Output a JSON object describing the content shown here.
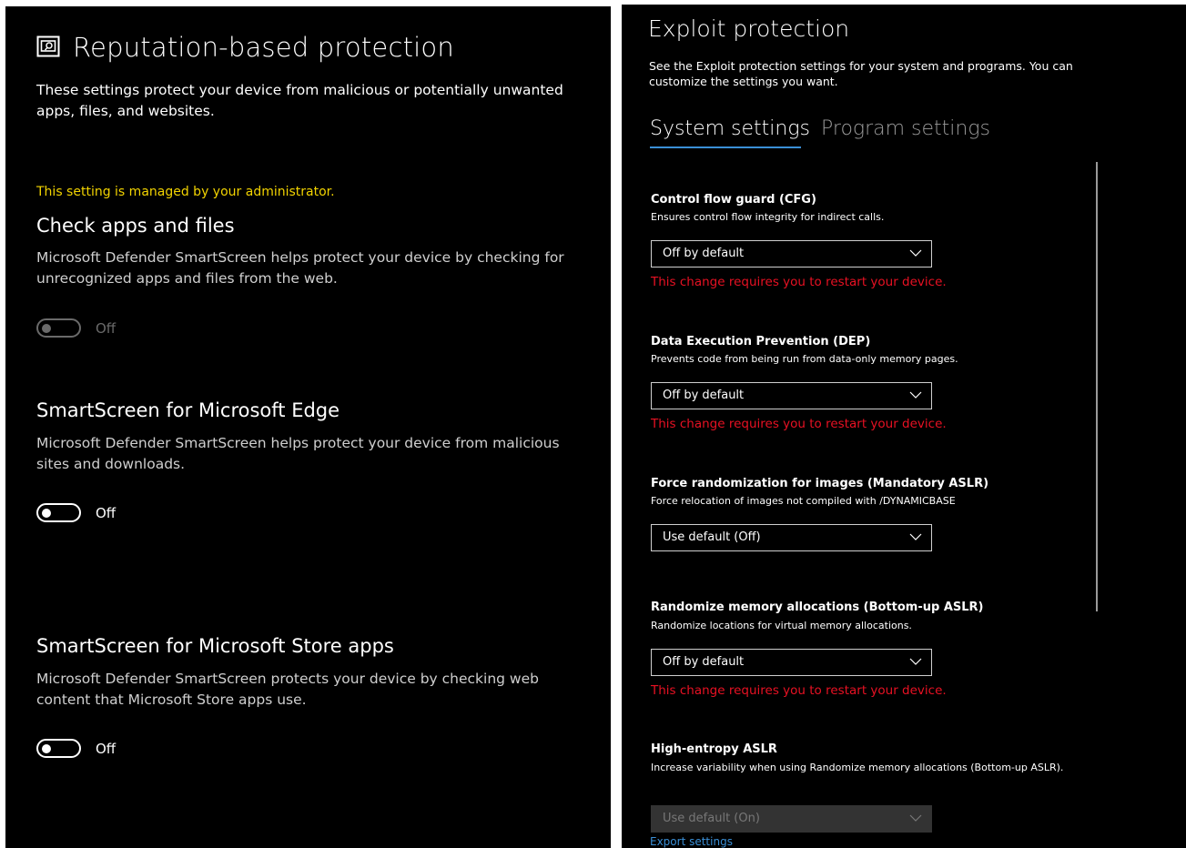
{
  "left": {
    "title": "Reputation-based protection",
    "description": "These settings protect your device from malicious or potentially unwanted apps, files, and websites.",
    "managed_notice": "This setting is managed by your administrator.",
    "sections": [
      {
        "heading": "Check apps and files",
        "text": "Microsoft Defender SmartScreen helps protect your device by checking for unrecognized apps and files from the web.",
        "toggle_label": "Off",
        "enabled": false
      },
      {
        "heading": "SmartScreen for Microsoft Edge",
        "text": "Microsoft Defender SmartScreen helps protect your device from malicious sites and downloads.",
        "toggle_label": "Off",
        "enabled": true
      },
      {
        "heading": "SmartScreen for Microsoft Store apps",
        "text": "Microsoft Defender SmartScreen protects your device by checking web content that Microsoft Store apps use.",
        "toggle_label": "Off",
        "enabled": true
      }
    ]
  },
  "right": {
    "title": "Exploit protection",
    "description": "See the Exploit protection settings for your system and programs.  You can customize the settings you want.",
    "tabs": [
      {
        "label": "System settings",
        "selected": true
      },
      {
        "label": "Program settings",
        "selected": false
      }
    ],
    "settings": [
      {
        "heading": "Control flow guard (CFG)",
        "description": "Ensures control flow integrity for indirect calls.",
        "value": "Off by default",
        "warning": "This change requires you to restart your device."
      },
      {
        "heading": "Data Execution Prevention (DEP)",
        "description": "Prevents code from being run from data-only memory pages.",
        "value": "Off by default",
        "warning": "This change requires you to restart your device."
      },
      {
        "heading": "Force randomization for images (Mandatory ASLR)",
        "description": "Force relocation of images not compiled with /DYNAMICBASE",
        "value": "Use default (Off)"
      },
      {
        "heading": "Randomize memory allocations (Bottom-up ASLR)",
        "description": "Randomize locations for virtual memory allocations.",
        "value": "Off by default",
        "warning": "This change requires you to restart your device."
      },
      {
        "heading": "High-entropy ASLR",
        "description": "Increase variability when using Randomize memory allocations (Bottom-up ASLR).",
        "value": "Use default (On)"
      }
    ],
    "export_link": "Export settings"
  },
  "colors": {
    "panel_bg": "#000000",
    "managed_notice": "#f2d300",
    "warning": "#e81123",
    "accent": "#3a8fd6",
    "disabled": "#6a6a6a"
  },
  "icons": [
    "reputation-shield-icon",
    "chevron-down-icon"
  ]
}
